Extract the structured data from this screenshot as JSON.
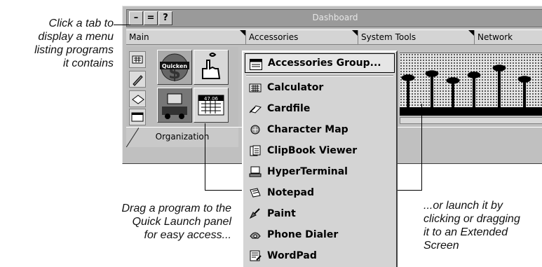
{
  "window": {
    "title": "Dashboard",
    "controls": [
      "–",
      "=",
      "?"
    ]
  },
  "tabs": [
    {
      "label": "Main"
    },
    {
      "label": "Accessories"
    },
    {
      "label": "System Tools"
    },
    {
      "label": "Network"
    }
  ],
  "organization_tab": "Organization",
  "icons": {
    "quicken_label": "Quicken",
    "calendar_label": "47.06"
  },
  "menu": {
    "group": "Accessories Group...",
    "items": [
      {
        "label": "Calculator",
        "icon": "calculator-icon"
      },
      {
        "label": "Cardfile",
        "icon": "cardfile-icon"
      },
      {
        "label": "Character Map",
        "icon": "character-map-icon"
      },
      {
        "label": "ClipBook Viewer",
        "icon": "clipbook-icon"
      },
      {
        "label": "HyperTerminal",
        "icon": "hyperterminal-icon"
      },
      {
        "label": "Notepad",
        "icon": "notepad-icon"
      },
      {
        "label": "Paint",
        "icon": "paint-icon"
      },
      {
        "label": "Phone Dialer",
        "icon": "phone-dialer-icon"
      },
      {
        "label": "WordPad",
        "icon": "wordpad-icon"
      }
    ]
  },
  "callouts": {
    "tab_hint": "Click a tab to\ndisplay a menu\nlisting programs\nit contains",
    "drag_hint": "Drag a program to the\nQuick Launch panel\nfor easy access...",
    "launch_hint": "...or launch it by\nclicking or dragging\nit to an Extended\nScreen"
  }
}
